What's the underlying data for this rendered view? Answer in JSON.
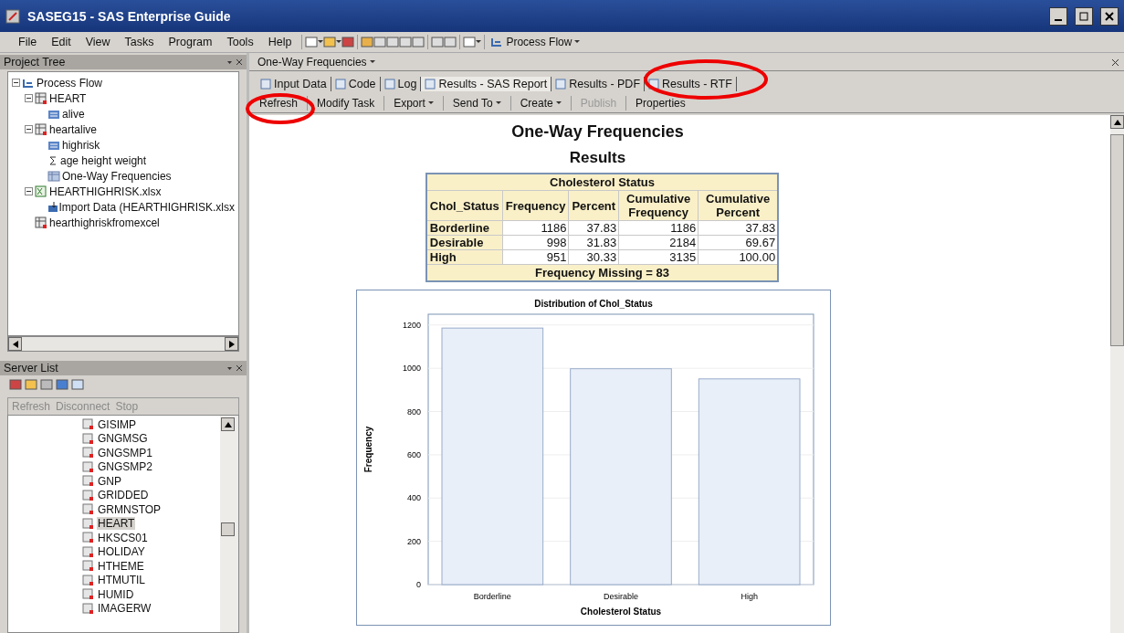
{
  "window": {
    "title": "SASEG15 - SAS Enterprise Guide"
  },
  "menu": [
    "File",
    "Edit",
    "View",
    "Tasks",
    "Program",
    "Tools",
    "Help"
  ],
  "toolbar": {
    "process_flow": "Process Flow"
  },
  "project_tree": {
    "title": "Project Tree",
    "items": [
      {
        "label": "Process Flow",
        "kind": "flow",
        "expanded": true,
        "children": [
          {
            "label": "HEART",
            "kind": "dataset",
            "expanded": true,
            "children": [
              {
                "label": "alive",
                "kind": "query"
              }
            ]
          },
          {
            "label": "heartalive",
            "kind": "dataset",
            "expanded": true,
            "children": [
              {
                "label": "highrisk",
                "kind": "query"
              },
              {
                "label": "age height weight",
                "kind": "summary"
              },
              {
                "label": "One-Way Frequencies",
                "kind": "report"
              }
            ]
          },
          {
            "label": "HEARTHIGHRISK.xlsx",
            "kind": "excel",
            "expanded": true,
            "children": [
              {
                "label": "Import Data (HEARTHIGHRISK.xlsx",
                "kind": "import"
              }
            ]
          },
          {
            "label": "hearthighriskfromexcel",
            "kind": "dataset"
          }
        ]
      }
    ]
  },
  "server_list": {
    "title": "Server List",
    "toolbar": [
      {
        "label": "Refresh",
        "disabled": true
      },
      {
        "label": "Disconnect",
        "disabled": true
      },
      {
        "label": "Stop",
        "disabled": true
      }
    ],
    "items": [
      {
        "label": "GISIMP",
        "selected": false
      },
      {
        "label": "GNGMSG",
        "selected": false
      },
      {
        "label": "GNGSMP1",
        "selected": false
      },
      {
        "label": "GNGSMP2",
        "selected": false
      },
      {
        "label": "GNP",
        "selected": false
      },
      {
        "label": "GRIDDED",
        "selected": false
      },
      {
        "label": "GRMNSTOP",
        "selected": false
      },
      {
        "label": "HEART",
        "selected": true
      },
      {
        "label": "HKSCS01",
        "selected": false
      },
      {
        "label": "HOLIDAY",
        "selected": false
      },
      {
        "label": "HTHEME",
        "selected": false
      },
      {
        "label": "HTMUTIL",
        "selected": false
      },
      {
        "label": "HUMID",
        "selected": false
      },
      {
        "label": "IMAGERW",
        "selected": false
      }
    ]
  },
  "document": {
    "title": "One-Way Frequencies",
    "tabs": [
      {
        "label": "Input Data",
        "selected": false
      },
      {
        "label": "Code",
        "selected": false
      },
      {
        "label": "Log",
        "selected": false
      },
      {
        "label": "Results - SAS Report",
        "selected": true
      },
      {
        "label": "Results - PDF",
        "selected": false
      },
      {
        "label": "Results - RTF",
        "selected": false
      }
    ],
    "actions": [
      {
        "label": "Refresh",
        "dropdown": false,
        "disabled": false
      },
      {
        "label": "Modify Task",
        "dropdown": false,
        "disabled": false
      },
      {
        "label": "Export",
        "dropdown": true,
        "disabled": false
      },
      {
        "label": "Send To",
        "dropdown": true,
        "disabled": false
      },
      {
        "label": "Create",
        "dropdown": true,
        "disabled": false
      },
      {
        "label": "Publish",
        "dropdown": false,
        "disabled": true
      },
      {
        "label": "Properties",
        "dropdown": false,
        "disabled": false
      }
    ]
  },
  "report": {
    "title": "One-Way Frequencies",
    "subtitle": "Results",
    "table": {
      "caption": "Cholesterol Status",
      "columns": [
        "Chol_Status",
        "Frequency",
        "Percent",
        "Cumulative Frequency",
        "Cumulative Percent"
      ],
      "rows": [
        [
          "Borderline",
          "1186",
          "37.83",
          "1186",
          "37.83"
        ],
        [
          "Desirable",
          "998",
          "31.83",
          "2184",
          "69.67"
        ],
        [
          "High",
          "951",
          "30.33",
          "3135",
          "100.00"
        ]
      ],
      "footer": "Frequency Missing = 83"
    },
    "chart_data": {
      "type": "bar",
      "grid": true,
      "title": "Distribution of Chol_Status",
      "xlabel": "Cholesterol Status",
      "ylabel": "Frequency",
      "categories": [
        "Borderline",
        "Desirable",
        "High"
      ],
      "values": [
        1186,
        998,
        951
      ],
      "ylim": [
        0,
        1250
      ],
      "yticks": [
        0,
        200,
        400,
        600,
        800,
        1000,
        1200
      ]
    }
  }
}
